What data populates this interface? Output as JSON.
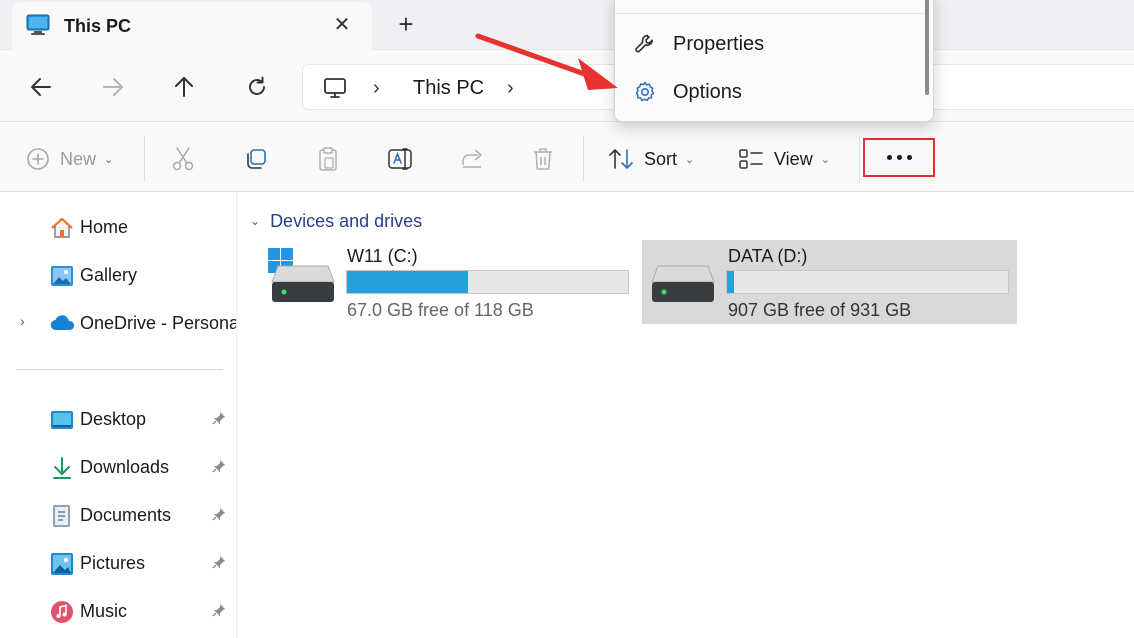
{
  "tab": {
    "title": "This PC",
    "close_glyph": "✕",
    "new_tab_glyph": "+"
  },
  "nav": {
    "back": "back-arrow-icon",
    "forward": "forward-arrow-icon",
    "up": "up-arrow-icon",
    "refresh": "refresh-icon"
  },
  "address": {
    "chevron": "›",
    "location": "This PC"
  },
  "toolbar": {
    "new_label": "New",
    "sort_label": "Sort",
    "view_label": "View",
    "caret": "⌄"
  },
  "menu": {
    "items": [
      {
        "label": "Properties",
        "icon": "wrench-icon"
      },
      {
        "label": "Options",
        "icon": "gear-icon"
      }
    ]
  },
  "sidebar": {
    "expander": "›",
    "items": [
      {
        "label": "Home",
        "icon": "home-icon"
      },
      {
        "label": "Gallery",
        "icon": "gallery-icon"
      },
      {
        "label": "OneDrive - Persona",
        "icon": "onedrive-icon"
      },
      {
        "label": "Desktop",
        "icon": "desktop-icon",
        "pinned": true
      },
      {
        "label": "Downloads",
        "icon": "downloads-icon",
        "pinned": true
      },
      {
        "label": "Documents",
        "icon": "documents-icon",
        "pinned": true
      },
      {
        "label": "Pictures",
        "icon": "pictures-icon",
        "pinned": true
      },
      {
        "label": "Music",
        "icon": "music-icon",
        "pinned": true
      }
    ]
  },
  "content": {
    "group_label": "Devices and drives",
    "group_chevron": "⌄",
    "drives": [
      {
        "name": "W11 (C:)",
        "free_text": "67.0 GB free of 118 GB",
        "used_fraction": 0.43,
        "selected": false
      },
      {
        "name": "DATA (D:)",
        "free_text": "907 GB free of 931 GB",
        "used_fraction": 0.026,
        "selected": true
      }
    ]
  },
  "colors": {
    "accent": "#26a0da",
    "highlight_box": "#e03030",
    "selected_bg": "#d9d9d9"
  }
}
